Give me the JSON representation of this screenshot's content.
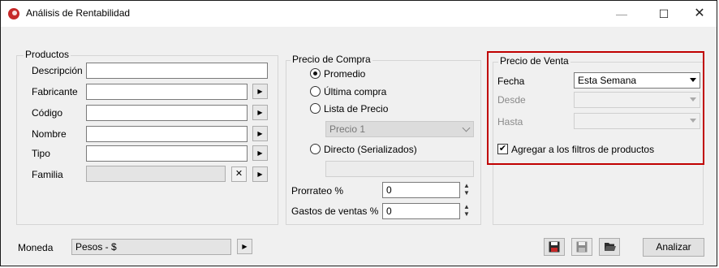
{
  "window": {
    "title": "Análisis de Rentabilidad",
    "minimize_icon": "—",
    "maximize_icon": "☐",
    "close_icon": "✕"
  },
  "productos": {
    "group_label": "Productos",
    "fields": [
      {
        "label": "Descripción",
        "value": ""
      },
      {
        "label": "Fabricante",
        "value": ""
      },
      {
        "label": "Código",
        "value": ""
      },
      {
        "label": "Nombre",
        "value": ""
      },
      {
        "label": "Tipo",
        "value": ""
      },
      {
        "label": "Familia",
        "value": ""
      }
    ],
    "arrow_glyph": "▶",
    "clear_glyph": "✕"
  },
  "precio_compra": {
    "group_label": "Precio de Compra",
    "options": [
      "Promedio",
      "Última compra",
      "Lista de Precio",
      "Directo (Serializados)"
    ],
    "selected": "Promedio",
    "lista_value": "Precio 1",
    "directo_value": "",
    "prorrateo": {
      "label": "Prorrateo %",
      "value": "0"
    },
    "gastos": {
      "label": "Gastos de ventas %",
      "value": "0"
    },
    "spin_up": "▲",
    "spin_down": "▼"
  },
  "precio_venta": {
    "group_label": "Precio de Venta",
    "fecha": {
      "label": "Fecha",
      "value": "Esta Semana"
    },
    "desde": {
      "label": "Desde",
      "value": ""
    },
    "hasta": {
      "label": "Hasta",
      "value": ""
    },
    "agregar": {
      "label": "Agregar a los filtros de productos",
      "checked": true,
      "check_glyph": "✔"
    },
    "highlight_color": "#c00000"
  },
  "footer": {
    "moneda_label": "Moneda",
    "moneda_value": "Pesos - $",
    "analizar_label": "Analizar",
    "icons": [
      "save-icon",
      "save-as-icon",
      "open-folder-icon"
    ]
  }
}
